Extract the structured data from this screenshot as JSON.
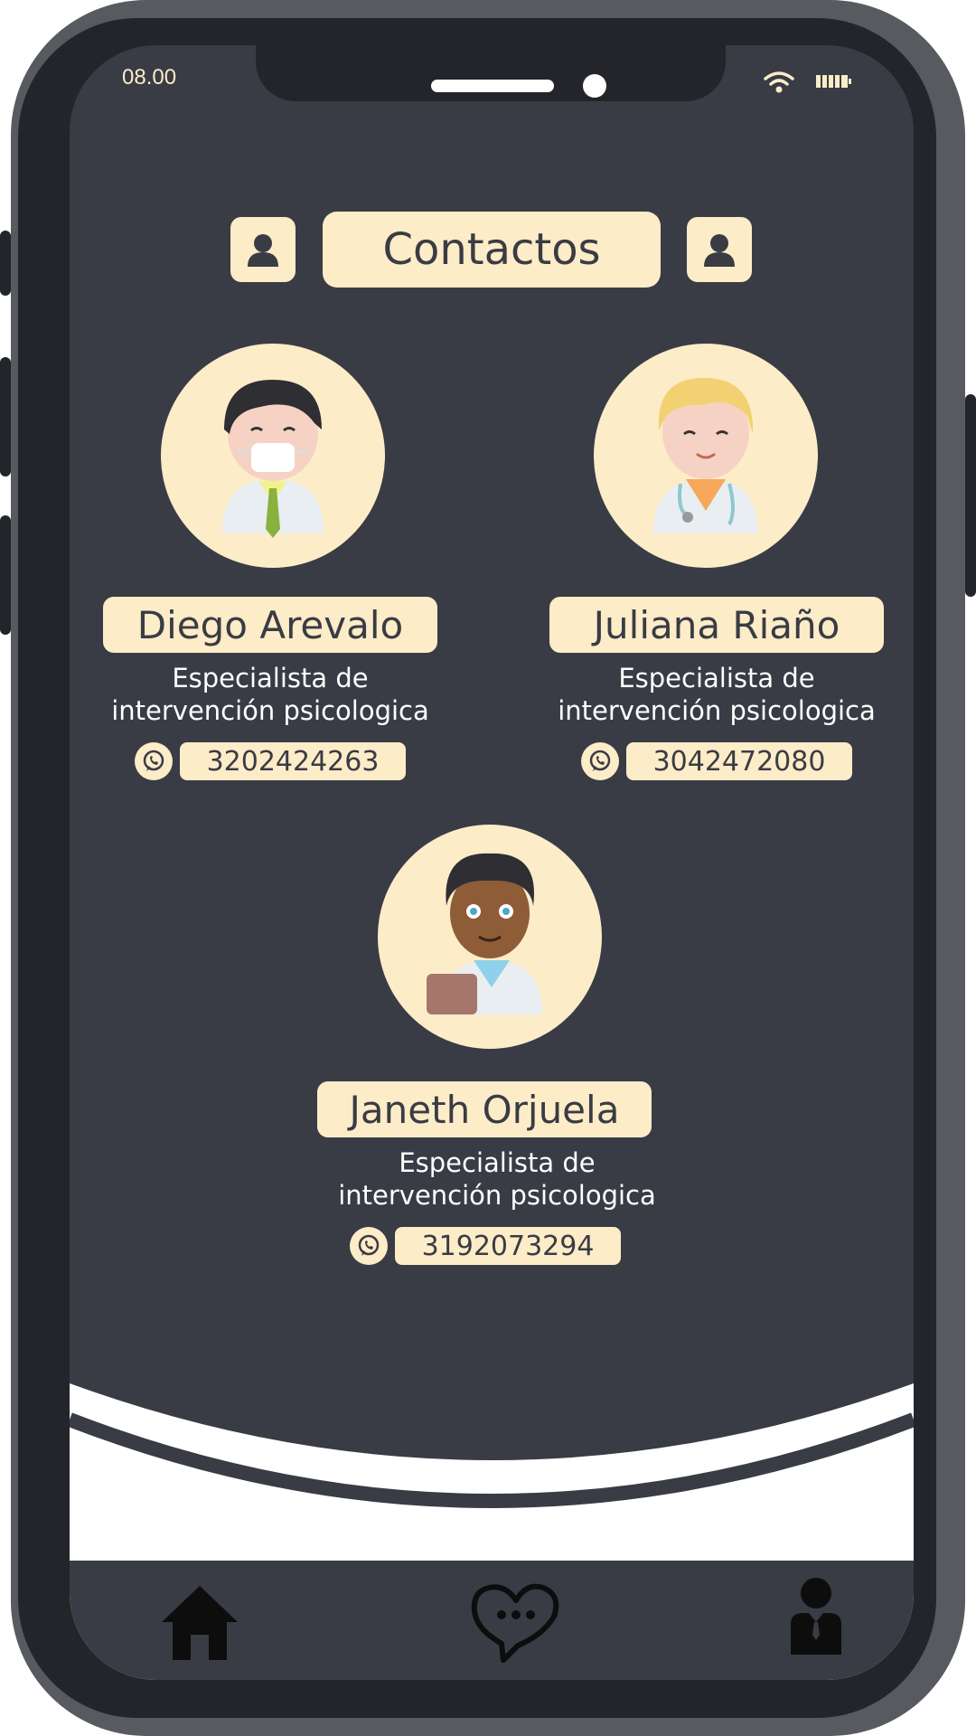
{
  "status_bar": {
    "time": "08.00"
  },
  "header": {
    "title": "Contactos"
  },
  "contacts": [
    {
      "name": "Diego Arevalo",
      "role_line1": "Especialista de",
      "role_line2": "intervención psicologica",
      "phone": "3202424263"
    },
    {
      "name": "Juliana Riaño",
      "role_line1": "Especialista de",
      "role_line2": "intervención psicologica",
      "phone": "3042472080"
    },
    {
      "name": "Janeth Orjuela",
      "role_line1": "Especialista de",
      "role_line2": "intervención psicologica",
      "phone": "3192073294"
    }
  ],
  "colors": {
    "accent": "#fdecc8",
    "screen_bg": "#393c45",
    "frame": "#575a5f"
  },
  "nav": {
    "items": [
      "home-icon",
      "chat-heart-icon",
      "profile-icon"
    ]
  }
}
